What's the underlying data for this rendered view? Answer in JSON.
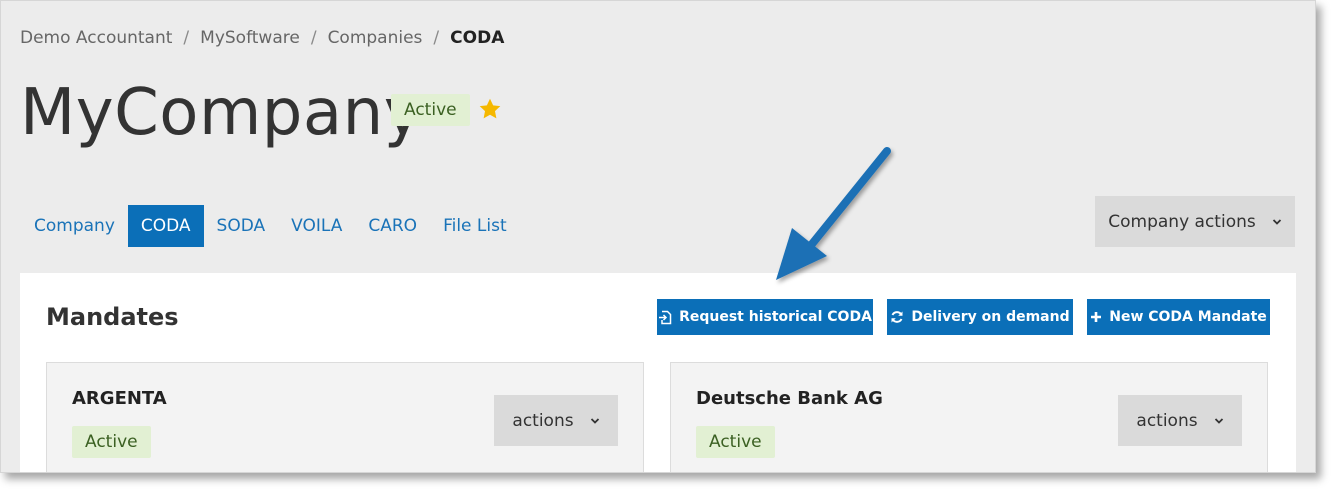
{
  "breadcrumb": {
    "items": [
      "Demo Accountant",
      "MySoftware",
      "Companies"
    ],
    "current": "CODA",
    "separator": "/"
  },
  "header": {
    "title": "MyCompany",
    "status": "Active",
    "favorite_icon": "star-icon"
  },
  "tabs": [
    {
      "label": "Company",
      "active": false
    },
    {
      "label": "CODA",
      "active": true
    },
    {
      "label": "SODA",
      "active": false
    },
    {
      "label": "VOILA",
      "active": false
    },
    {
      "label": "CARO",
      "active": false
    },
    {
      "label": "File List",
      "active": false
    }
  ],
  "company_actions_label": "Company actions",
  "mandates": {
    "title": "Mandates",
    "buttons": {
      "request_historical": "Request historical CODA",
      "delivery_on_demand": "Delivery on demand",
      "new_mandate": "New CODA Mandate"
    },
    "cards": [
      {
        "bank": "ARGENTA",
        "status": "Active",
        "actions_label": "actions"
      },
      {
        "bank": "Deutsche Bank AG",
        "status": "Active",
        "actions_label": "actions"
      }
    ]
  },
  "colors": {
    "accent": "#0b6fb8",
    "status_bg": "#e2f0d3",
    "status_text": "#3b6022",
    "star": "#f5b800",
    "annotation_arrow": "#1a6fb5"
  }
}
